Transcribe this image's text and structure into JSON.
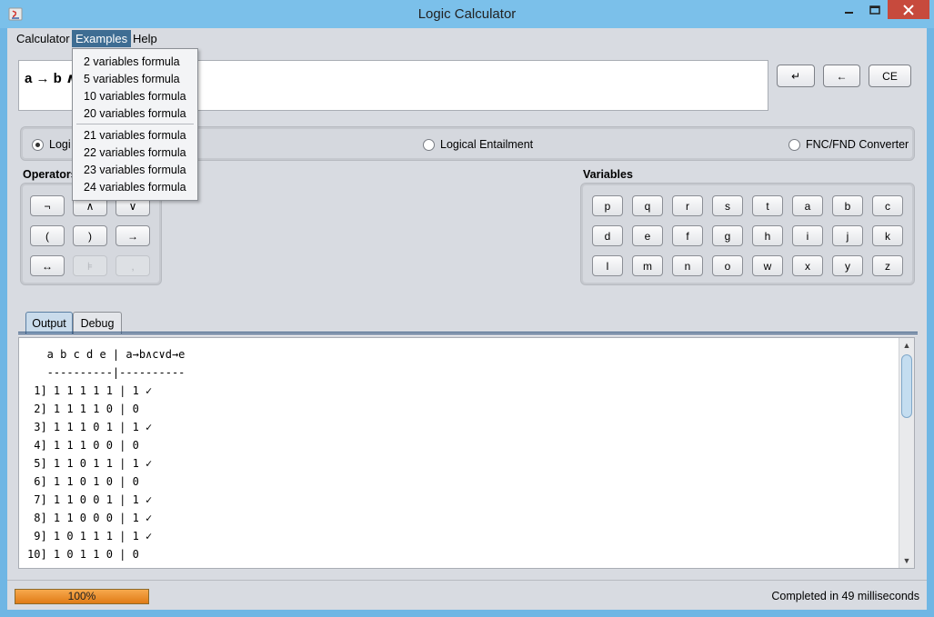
{
  "window": {
    "title": "Logic Calculator"
  },
  "menu": {
    "calculator": "Calculator",
    "examples": "Examples",
    "help": "Help"
  },
  "examples_menu": {
    "items": [
      "2 variables formula",
      "5 variables formula",
      "10 variables formula",
      "20 variables formula",
      "21 variables formula",
      "22 variables formula",
      "23 variables formula",
      "24 variables formula"
    ]
  },
  "formula": {
    "value": "a → b ∧"
  },
  "buttons": {
    "enter": "↵",
    "back": "←",
    "ce": "CE"
  },
  "modes": {
    "logic": "Logi",
    "entailment": "Logical Entailment",
    "converter": "FNC/FND Converter",
    "selected": "logic"
  },
  "operators": {
    "label": "Operators",
    "keys": [
      "¬",
      "∧",
      "∨",
      "(",
      ")",
      "→",
      "↔",
      "⊧",
      ","
    ]
  },
  "variables": {
    "label": "Variables",
    "keys": [
      "p",
      "q",
      "r",
      "s",
      "t",
      "a",
      "b",
      "c",
      "d",
      "e",
      "f",
      "g",
      "h",
      "i",
      "j",
      "k",
      "l",
      "m",
      "n",
      "o",
      "w",
      "x",
      "y",
      "z"
    ]
  },
  "tabs": {
    "output": "Output",
    "debug": "Debug"
  },
  "output": {
    "lines": [
      "   a b c d e | a→b∧c∨d→e",
      "   ----------|----------",
      " 1] 1 1 1 1 1 | 1 ✓",
      " 2] 1 1 1 1 0 | 0",
      " 3] 1 1 1 0 1 | 1 ✓",
      " 4] 1 1 1 0 0 | 0",
      " 5] 1 1 0 1 1 | 1 ✓",
      " 6] 1 1 0 1 0 | 0",
      " 7] 1 1 0 0 1 | 1 ✓",
      " 8] 1 1 0 0 0 | 1 ✓",
      " 9] 1 0 1 1 1 | 1 ✓",
      "10] 1 0 1 1 0 | 0"
    ]
  },
  "status": {
    "progress": 100,
    "progress_label": "100%",
    "message": "Completed in 49 milliseconds"
  },
  "colors": {
    "titlebar": "#7bc0ea",
    "menu_highlight": "#3e6d93",
    "progress": "#e98d26",
    "close": "#c74a3d"
  }
}
